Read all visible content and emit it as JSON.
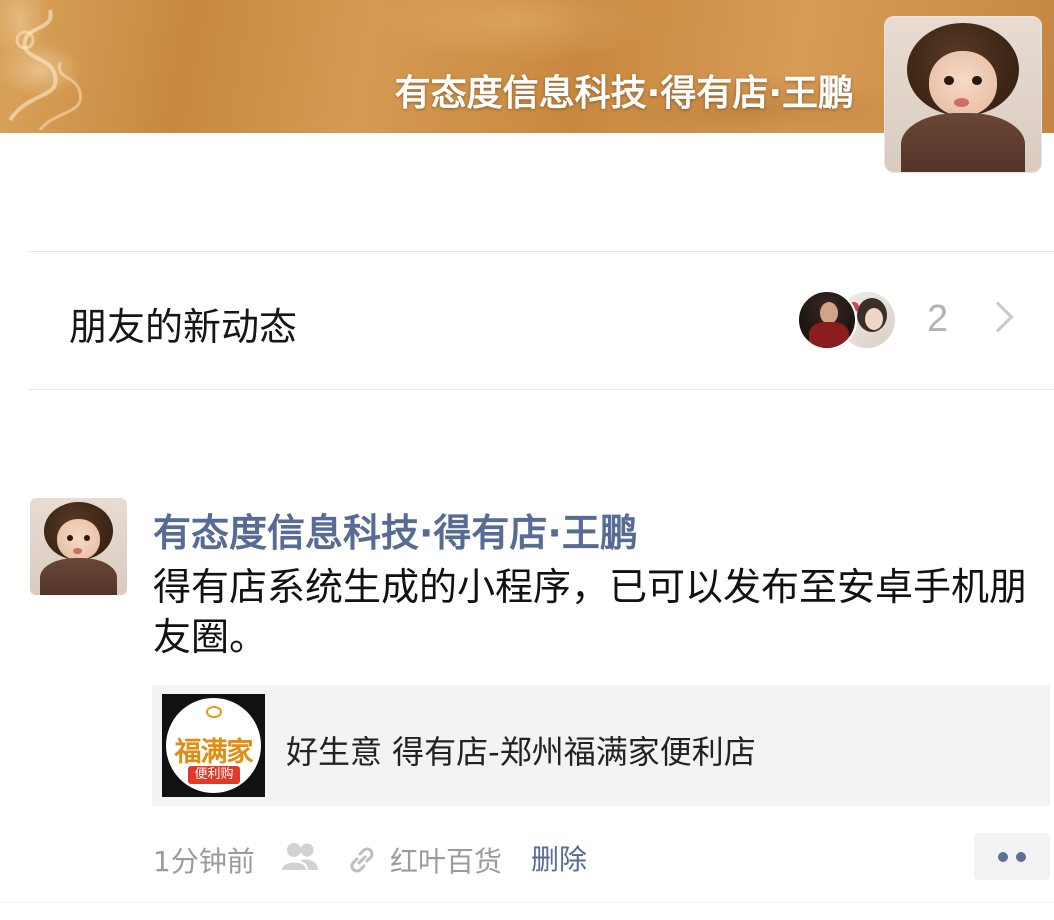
{
  "profile": {
    "cover_name": "有态度信息科技·得有店·王鹏",
    "avatar_icon": "child-photo-avatar"
  },
  "friends_feed": {
    "label": "朋友的新动态",
    "count": "2",
    "avatars": [
      "friend-avatar-1",
      "friend-avatar-2"
    ]
  },
  "post": {
    "author": "有态度信息科技·得有店·王鹏",
    "text": "得有店系统生成的小程序，已可以发布至安卓手机朋友圈。",
    "share": {
      "logo_main": "福满家",
      "logo_sub": "便利购",
      "title": "好生意  得有店-郑州福满家便利店"
    },
    "time": "1分钟前",
    "location": "红叶百货",
    "delete_label": "删除"
  },
  "colors": {
    "link_blue": "#576b95",
    "meta_gray": "#9b9b9b",
    "card_bg": "#f3f3f5"
  }
}
